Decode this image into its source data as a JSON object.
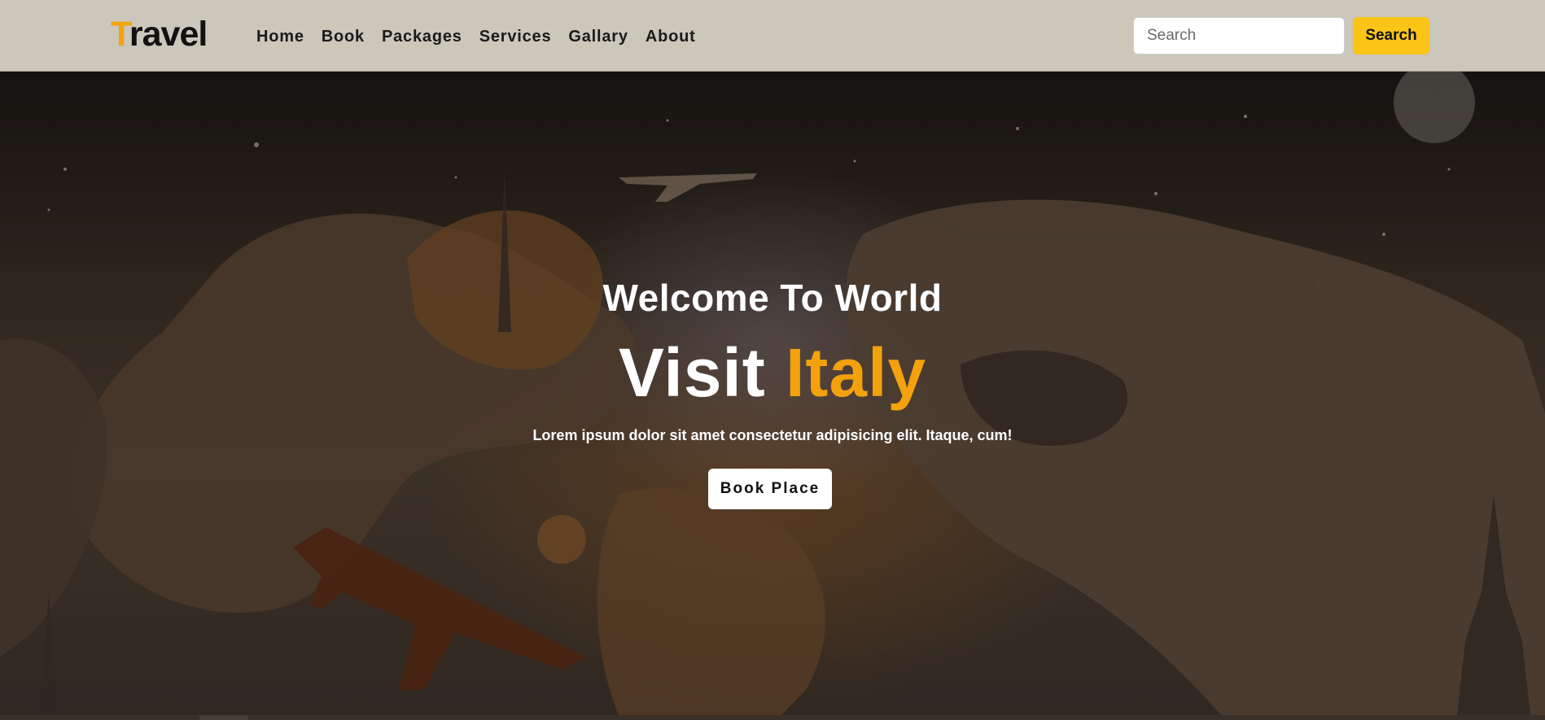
{
  "brand": {
    "first_letter": "T",
    "rest": "ravel"
  },
  "nav": {
    "items": [
      {
        "label": "Home"
      },
      {
        "label": "Book"
      },
      {
        "label": "Packages"
      },
      {
        "label": "Services"
      },
      {
        "label": "Gallary"
      },
      {
        "label": "About"
      }
    ]
  },
  "search": {
    "placeholder": "Search",
    "value": "",
    "button_label": "Search"
  },
  "hero": {
    "subtitle": "Welcome To World",
    "title_prefix": "Visit ",
    "title_highlight": "Italy",
    "text": "Lorem ipsum dolor sit amet consectetur adipisicing elit. Itaque, cum!",
    "cta_label": "Book Place"
  },
  "colors": {
    "accent": "#f3a10d",
    "navbar_bg": "#cbc7bb",
    "search_button_bg": "#fcc416"
  }
}
